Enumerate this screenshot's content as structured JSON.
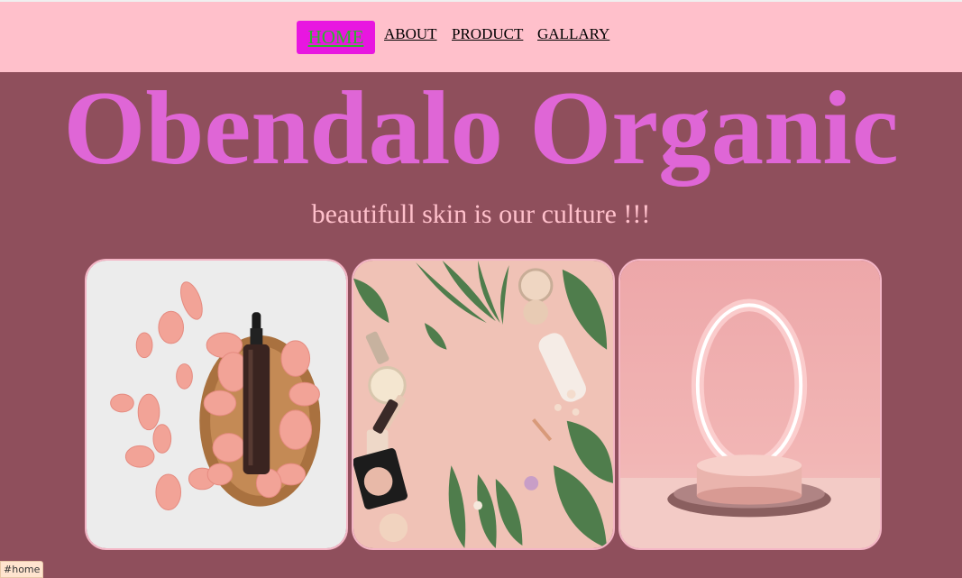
{
  "nav": {
    "items": [
      {
        "label": "HOME",
        "active": true
      },
      {
        "label": "ABOUT"
      },
      {
        "label": "PRODUCT"
      },
      {
        "label": "GALLARY"
      }
    ]
  },
  "hero": {
    "title": "Obendalo Organic",
    "tagline": "beautifull skin is our culture !!!"
  },
  "gallery": {
    "images": [
      {
        "name": "rose-petals-serum-image"
      },
      {
        "name": "makeup-flatlay-image"
      },
      {
        "name": "podium-ring-light-image"
      }
    ]
  },
  "status_bar": {
    "url": "#home"
  },
  "colors": {
    "page_background": "#8f4f5c",
    "nav_background": "#ffc0cb",
    "active_tab": "#e816e0",
    "title": "#df66d6",
    "tagline": "#ffc0cb"
  }
}
